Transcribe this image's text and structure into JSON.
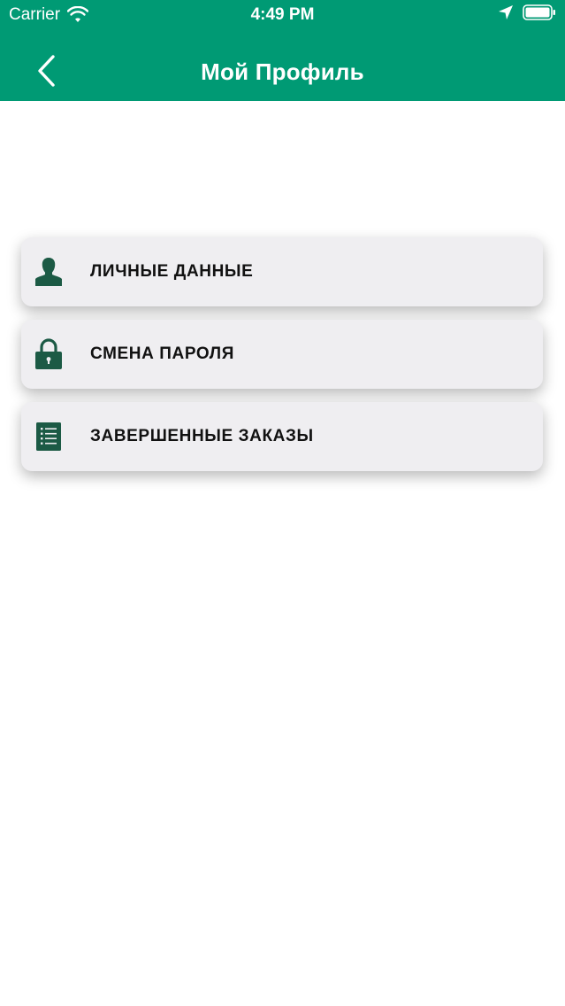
{
  "status_bar": {
    "carrier": "Carrier",
    "time": "4:49 PM",
    "icons": [
      "wifi-icon",
      "location-arrow-icon",
      "battery-icon"
    ]
  },
  "navbar": {
    "title": "Мой Профиль",
    "back_icon": "chevron-left-icon"
  },
  "menu": {
    "items": [
      {
        "label": "ЛИЧНЫЕ ДАННЫЕ",
        "icon": "user-silhouette-icon"
      },
      {
        "label": "СМЕНА ПАРОЛЯ",
        "icon": "padlock-icon"
      },
      {
        "label": "ЗАВЕРШЕННЫЕ ЗАКАЗЫ",
        "icon": "list-document-icon"
      }
    ]
  },
  "colors": {
    "header_bg": "#009a74",
    "header_text": "#ffffff",
    "icon_color": "#1c5a45",
    "card_bg": "#efeef1",
    "label_text": "#111111"
  }
}
